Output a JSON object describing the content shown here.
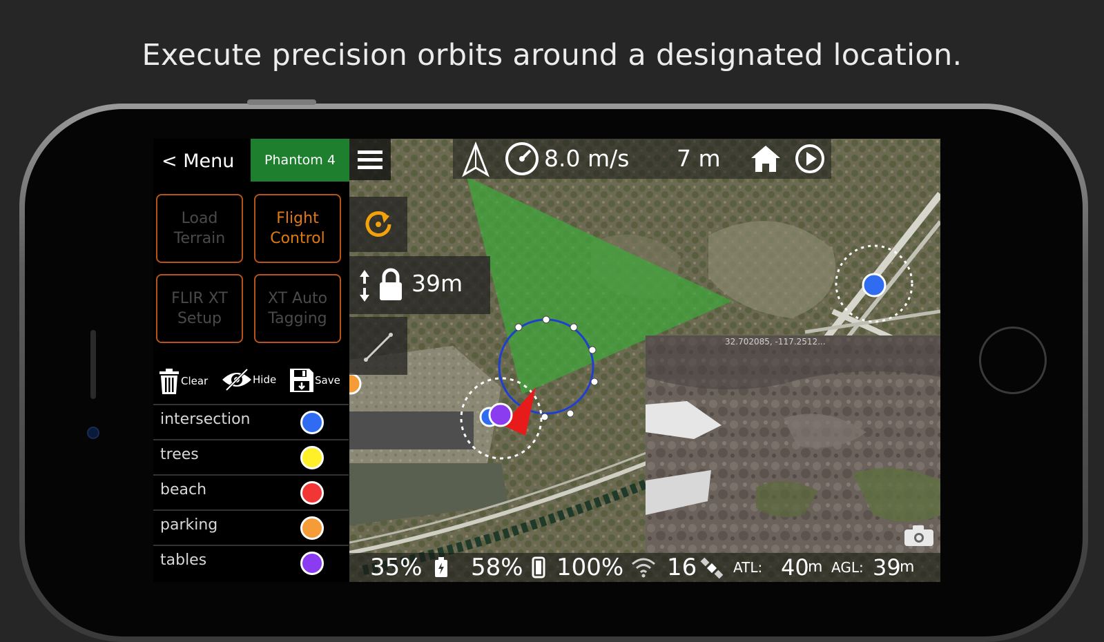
{
  "headline": "Execute precision orbits around a designated location.",
  "panel": {
    "menu_label": "< Menu",
    "aircraft_label": "Phantom 4",
    "buttons": [
      {
        "label": "Load Terrain",
        "active": false
      },
      {
        "label": "Flight Control",
        "active": true
      },
      {
        "label": "FLIR XT Setup",
        "active": false
      },
      {
        "label": "XT Auto Tagging",
        "active": false
      }
    ],
    "tools": {
      "clear": "Clear",
      "hide": "Hide",
      "save": "Save"
    },
    "legend": [
      {
        "label": "intersection",
        "color": "#2f6cf2"
      },
      {
        "label": "trees",
        "color": "#fff02a"
      },
      {
        "label": "beach",
        "color": "#f23535"
      },
      {
        "label": "parking",
        "color": "#f59b38"
      },
      {
        "label": "tables",
        "color": "#8b3cf0"
      }
    ]
  },
  "map": {
    "speed": "8.0 m/s",
    "distance": "7 m",
    "altitude_lock": "39m",
    "pip_coordinates": "32.702085, -117.2512..."
  },
  "status": {
    "aircraft_battery": "35%",
    "phone_battery": "58%",
    "signal": "100%",
    "satellites": "16",
    "atl_label": "ATL:",
    "atl_value": "40",
    "atl_unit": "m",
    "agl_label": "AGL:",
    "agl_value": "39",
    "agl_unit": "m"
  },
  "colors": {
    "accent_orange": "#e07a10",
    "phantom_green": "#1e7f2e",
    "fov_green": "#3ea83a",
    "orbit_blue": "#1f3fd1"
  }
}
